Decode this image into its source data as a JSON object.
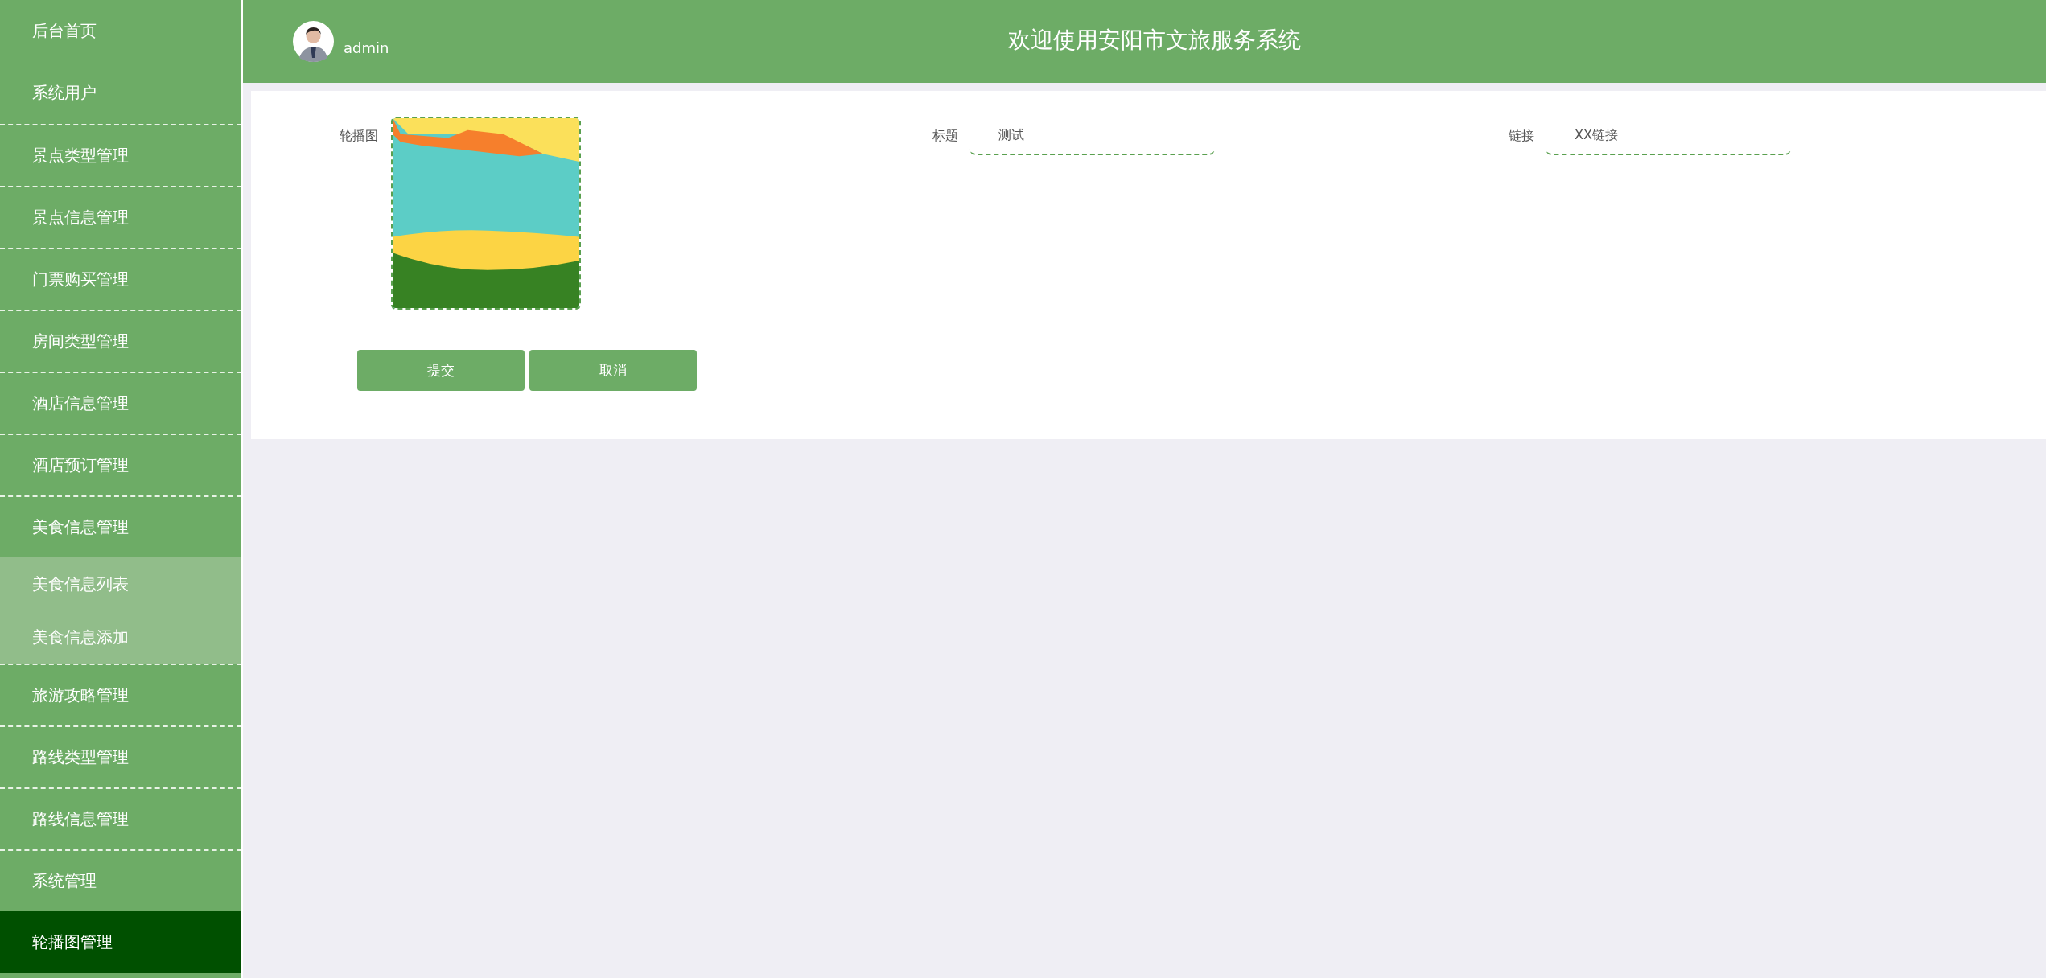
{
  "sidebar": {
    "items": [
      {
        "label": "后台首页",
        "selected": false,
        "divider": false
      },
      {
        "label": "系统用户",
        "selected": false,
        "divider": false
      },
      {
        "label": "景点类型管理",
        "selected": false,
        "divider": true
      },
      {
        "label": "景点信息管理",
        "selected": false,
        "divider": true
      },
      {
        "label": "门票购买管理",
        "selected": false,
        "divider": true
      },
      {
        "label": "房间类型管理",
        "selected": false,
        "divider": true
      },
      {
        "label": "酒店信息管理",
        "selected": false,
        "divider": true
      },
      {
        "label": "酒店预订管理",
        "selected": false,
        "divider": true
      },
      {
        "label": "美食信息管理",
        "selected": false,
        "divider": true,
        "expanded": true,
        "children": [
          {
            "label": "美食信息列表"
          },
          {
            "label": "美食信息添加"
          }
        ]
      },
      {
        "label": "旅游攻略管理",
        "selected": false,
        "divider": true
      },
      {
        "label": "路线类型管理",
        "selected": false,
        "divider": true
      },
      {
        "label": "路线信息管理",
        "selected": false,
        "divider": true
      },
      {
        "label": "系统管理",
        "selected": false,
        "divider": true
      },
      {
        "label": "轮播图管理",
        "selected": true,
        "divider": false
      }
    ]
  },
  "header": {
    "user": "admin",
    "title": "欢迎使用安阳市文旅服务系统"
  },
  "form": {
    "image_label": "轮播图",
    "fields": [
      {
        "label": "标题",
        "value": "测试"
      },
      {
        "label": "链接",
        "value": "XX链接"
      }
    ],
    "buttons": [
      "提交",
      "取消"
    ]
  }
}
